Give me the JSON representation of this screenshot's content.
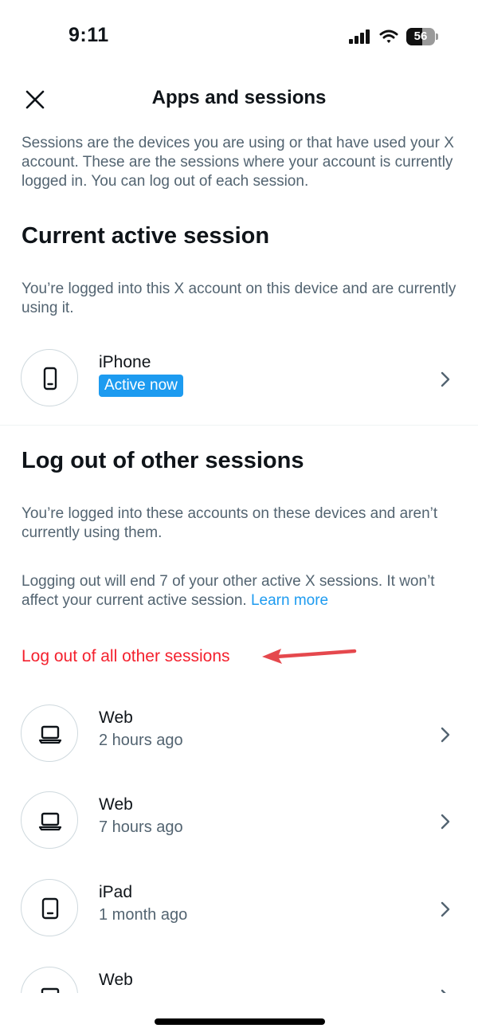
{
  "status_bar": {
    "time": "9:11",
    "battery": "56",
    "battery_level": 0.56
  },
  "header": {
    "title": "Apps and sessions",
    "close_icon": "close-icon"
  },
  "intro": "Sessions are the devices you are using or that have used your X account. These are the sessions where your account is currently logged in. You can log out of each session.",
  "current_session": {
    "heading": "Current active session",
    "description": "You’re logged into this X account on this device and are currently using it.",
    "device": {
      "name": "iPhone",
      "badge": "Active now",
      "icon": "phone-icon"
    }
  },
  "other_sessions": {
    "heading": "Log out of other sessions",
    "description": "You’re logged into these accounts on these devices and aren’t currently using them.",
    "notice": "Logging out will end 7 of your other active X sessions. It won’t affect your current active session.",
    "learn_more": "Learn more",
    "logout_all": "Log out of all other sessions",
    "sessions": [
      {
        "name": "Web",
        "time": "2 hours ago",
        "icon": "laptop-icon"
      },
      {
        "name": "Web",
        "time": "7 hours ago",
        "icon": "laptop-icon"
      },
      {
        "name": "iPad",
        "time": "1 month ago",
        "icon": "tablet-icon"
      },
      {
        "name": "Web",
        "time": "",
        "icon": "laptop-icon"
      }
    ]
  },
  "colors": {
    "accent_blue": "#1d9bf0",
    "danger_red": "#f4212e",
    "annotation_arrow": "#e5484d",
    "secondary_text": "#536471"
  }
}
